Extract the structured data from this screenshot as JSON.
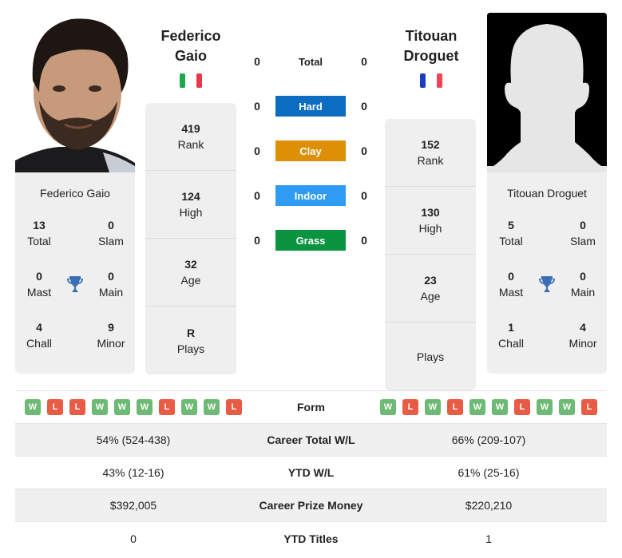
{
  "colors": {
    "hard": "#0A6DC2",
    "clay": "#DD8F05",
    "indoor": "#2E9BF5",
    "grass": "#0A9440",
    "win": "#6DBA75",
    "loss": "#E85B45",
    "trophy": "#3C6EB8",
    "italy_green": "#1FA84A",
    "italy_red": "#E8394A",
    "france_blue": "#1A3EBF",
    "france_red": "#F04455"
  },
  "player1": {
    "heading_line1": "Federico",
    "heading_line2": "Gaio",
    "flag": "italy-flag",
    "card_name": "Federico Gaio",
    "titles": {
      "total": "13",
      "total_label": "Total",
      "slam": "0",
      "slam_label": "Slam",
      "mast": "0",
      "mast_label": "Mast",
      "main": "0",
      "main_label": "Main",
      "chall": "4",
      "chall_label": "Chall",
      "minor": "9",
      "minor_label": "Minor"
    },
    "stats": [
      {
        "value": "419",
        "label": "Rank"
      },
      {
        "value": "124",
        "label": "High"
      },
      {
        "value": "32",
        "label": "Age"
      },
      {
        "value": "R",
        "label": "Plays"
      }
    ],
    "form": [
      "W",
      "L",
      "L",
      "W",
      "W",
      "W",
      "L",
      "W",
      "W",
      "L"
    ]
  },
  "player2": {
    "heading_line1": "Titouan",
    "heading_line2": "Droguet",
    "flag": "france-flag",
    "card_name": "Titouan Droguet",
    "titles": {
      "total": "5",
      "total_label": "Total",
      "slam": "0",
      "slam_label": "Slam",
      "mast": "0",
      "mast_label": "Mast",
      "main": "0",
      "main_label": "Main",
      "chall": "1",
      "chall_label": "Chall",
      "minor": "4",
      "minor_label": "Minor"
    },
    "stats": [
      {
        "value": "152",
        "label": "Rank"
      },
      {
        "value": "130",
        "label": "High"
      },
      {
        "value": "23",
        "label": "Age"
      },
      {
        "value": "",
        "label": "Plays"
      }
    ],
    "form": [
      "W",
      "L",
      "W",
      "L",
      "W",
      "W",
      "L",
      "W",
      "W",
      "L"
    ]
  },
  "h2h": [
    {
      "label": "Total",
      "p1": "0",
      "p2": "0"
    },
    {
      "label": "Hard",
      "p1": "0",
      "p2": "0"
    },
    {
      "label": "Clay",
      "p1": "0",
      "p2": "0"
    },
    {
      "label": "Indoor",
      "p1": "0",
      "p2": "0"
    },
    {
      "label": "Grass",
      "p1": "0",
      "p2": "0"
    }
  ],
  "table": {
    "form_label": "Form",
    "rows": [
      {
        "label": "Career Total W/L",
        "p1": "54% (524-438)",
        "p2": "66% (209-107)"
      },
      {
        "label": "YTD W/L",
        "p1": "43% (12-16)",
        "p2": "61% (25-16)"
      },
      {
        "label": "Career Prize Money",
        "p1": "$392,005",
        "p2": "$220,210"
      },
      {
        "label": "YTD Titles",
        "p1": "0",
        "p2": "1"
      }
    ]
  }
}
